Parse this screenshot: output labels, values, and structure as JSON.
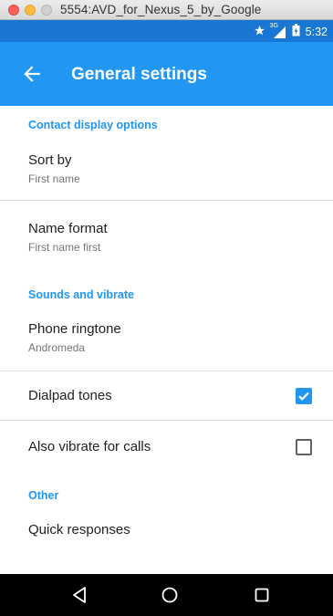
{
  "window": {
    "title": "5554:AVD_for_Nexus_5_by_Google"
  },
  "status_bar": {
    "network_label": "3G",
    "time": "5:32"
  },
  "app_bar": {
    "title": "General settings"
  },
  "sections": [
    {
      "header": "Contact display options",
      "items": [
        {
          "title": "Sort by",
          "summary": "First name"
        },
        {
          "title": "Name format",
          "summary": "First name first"
        }
      ]
    },
    {
      "header": "Sounds and vibrate",
      "items": [
        {
          "title": "Phone ringtone",
          "summary": "Andromeda"
        },
        {
          "title": "Dialpad tones",
          "checked": true
        },
        {
          "title": "Also vibrate for calls",
          "checked": false
        }
      ]
    },
    {
      "header": "Other",
      "items": [
        {
          "title": "Quick responses"
        }
      ]
    }
  ],
  "colors": {
    "status_bar": "#1976d2",
    "app_bar": "#2196f3",
    "accent": "#2196f3"
  }
}
